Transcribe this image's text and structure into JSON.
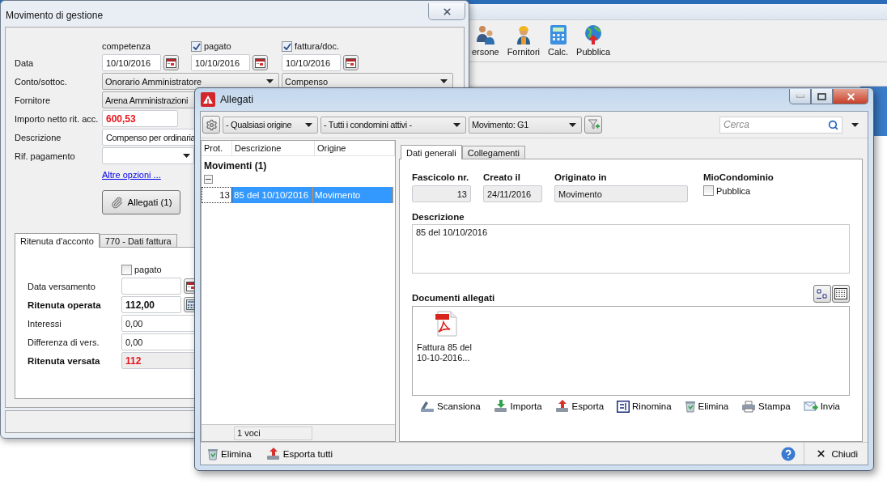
{
  "background_app": {
    "toolbar": [
      {
        "label": "ersone",
        "kind": "people"
      },
      {
        "label": "Fornitori",
        "kind": "worker"
      },
      {
        "label": "Calc.",
        "kind": "calculator"
      },
      {
        "label": "Pubblica",
        "kind": "globe"
      }
    ]
  },
  "movimento": {
    "title": "Movimento di gestione",
    "date_columns": [
      {
        "label": "competenza",
        "kind": "text"
      },
      {
        "label": "pagato",
        "kind": "checkbox",
        "checked": true
      },
      {
        "label": "fattura/doc.",
        "kind": "checkbox",
        "checked": true
      }
    ],
    "date_row": {
      "label": "Data",
      "values": [
        "10/10/2016",
        "10/10/2016",
        "10/10/2016"
      ]
    },
    "conto": {
      "label": "Conto/sottoc.",
      "values": [
        "Onorario Amministratore",
        "Compenso"
      ]
    },
    "fornitore": {
      "label": "Fornitore",
      "value": "Arena Amministrazioni"
    },
    "importo": {
      "label": "Importo netto rit. acc.",
      "value": "600,53"
    },
    "descrizione": {
      "label": "Descrizione",
      "value": "Compenso per ordinaria"
    },
    "rif_pagamento": {
      "label": "Rif. pagamento"
    },
    "link": "Altre opzioni ...",
    "allegati_button": "Allegati (1)",
    "tabs": [
      {
        "label": "Ritenuta d'acconto",
        "selected": true
      },
      {
        "label": "770 - Dati fattura",
        "selected": false
      }
    ],
    "ritenuta": {
      "paid": {
        "label": "pagato",
        "checked": false
      },
      "rows": [
        {
          "label": "Data versamento",
          "kind": "date",
          "bold": false
        },
        {
          "label": "Ritenuta operata",
          "value": "112,00",
          "kind": "calc",
          "bold": true
        },
        {
          "label": "Interessi",
          "value": "0,00",
          "kind": "plain",
          "bold": false
        },
        {
          "label": "Differenza di vers.",
          "value": "0,00",
          "kind": "plain",
          "bold": false
        },
        {
          "label": "Ritenuta versata",
          "value": "112",
          "kind": "total",
          "bold": true
        }
      ]
    }
  },
  "allegati": {
    "title": "Allegati",
    "filters": [
      {
        "kind": "settings"
      },
      {
        "kind": "combo",
        "value": "- Qualsiasi origine"
      },
      {
        "kind": "combo",
        "value": "- Tutti i condomini attivi -"
      },
      {
        "kind": "combo",
        "value": "Movimento: G1"
      },
      {
        "kind": "filter-add"
      }
    ],
    "search": {
      "placeholder": "Cerca"
    },
    "list": {
      "columns": [
        "Prot.",
        "Descrizione",
        "Origine"
      ],
      "groups": [
        {
          "title": "Movimenti (1)",
          "expanded": true,
          "rows": [
            {
              "cells": [
                "13",
                "85 del 10/10/2016",
                "Movimento"
              ],
              "selected": true
            }
          ]
        }
      ],
      "footer": "1 voci"
    },
    "detail": {
      "tabs": [
        {
          "label": "Dati generali",
          "selected": true
        },
        {
          "label": "Collegamenti",
          "selected": false
        }
      ],
      "fields": [
        {
          "label": "Fascicolo nr.",
          "value": "13",
          "kind": "number"
        },
        {
          "label": "Creato il",
          "value": "24/11/2016",
          "kind": "date"
        },
        {
          "label": "Originato in",
          "value": "Movimento",
          "kind": "text"
        }
      ],
      "mio": {
        "label": "MioCondominio",
        "option": {
          "label": "Pubblica",
          "checked": false
        }
      },
      "descrizione": {
        "label": "Descrizione",
        "value": "85 del 10/10/2016"
      },
      "documenti": {
        "label": "Documenti allegati",
        "files": [
          {
            "name": "Fattura 85 del 10-10-2016...",
            "kind": "pdf"
          }
        ]
      },
      "actions": [
        {
          "label": "Scansiona",
          "kind": "scan"
        },
        {
          "label": "Importa",
          "kind": "import"
        },
        {
          "label": "Esporta",
          "kind": "export"
        },
        {
          "label": "Rinomina",
          "kind": "rename"
        },
        {
          "label": "Elimina",
          "kind": "delete"
        },
        {
          "label": "Stampa",
          "kind": "print"
        },
        {
          "label": "Invia",
          "kind": "send"
        }
      ]
    },
    "bottom": {
      "actions": [
        {
          "label": "Elimina",
          "kind": "delete"
        },
        {
          "label": "Esporta tutti",
          "kind": "export"
        }
      ],
      "close": "Chiudi"
    }
  }
}
